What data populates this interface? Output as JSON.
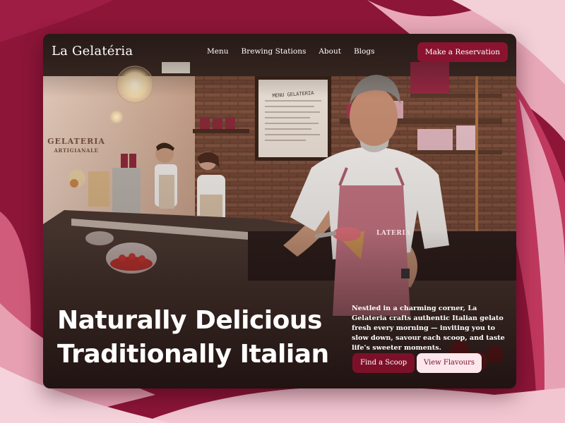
{
  "nav": {
    "brand": "La Gelatéria",
    "links": [
      "Menu",
      "Brewing Stations",
      "About",
      "Blogs"
    ],
    "cta": "Make a Reservation"
  },
  "hero": {
    "headline_line1": "Naturally Delicious",
    "headline_line2": "Traditionally Italian",
    "blurb": "Nestled in a charming corner, La Gelateria crafts authentic Italian gelato fresh every morning — inviting you to slow down, savour each scoop, and taste life's sweeter moments.",
    "primary_button": "Find a Scoop",
    "secondary_button": "View Flavours"
  },
  "scene": {
    "apron_text": "LATERIA",
    "wall_sign_line1": "GELATERIA",
    "wall_sign_line2": "ARTIGIANALE",
    "menu_board_title": "MENU GELATERIA"
  },
  "colors": {
    "page_background": "#8a1436",
    "wave_pink": "#f2c9d3",
    "brand_button": "#8a1330",
    "secondary_button_bg": "#fbe7ec"
  }
}
